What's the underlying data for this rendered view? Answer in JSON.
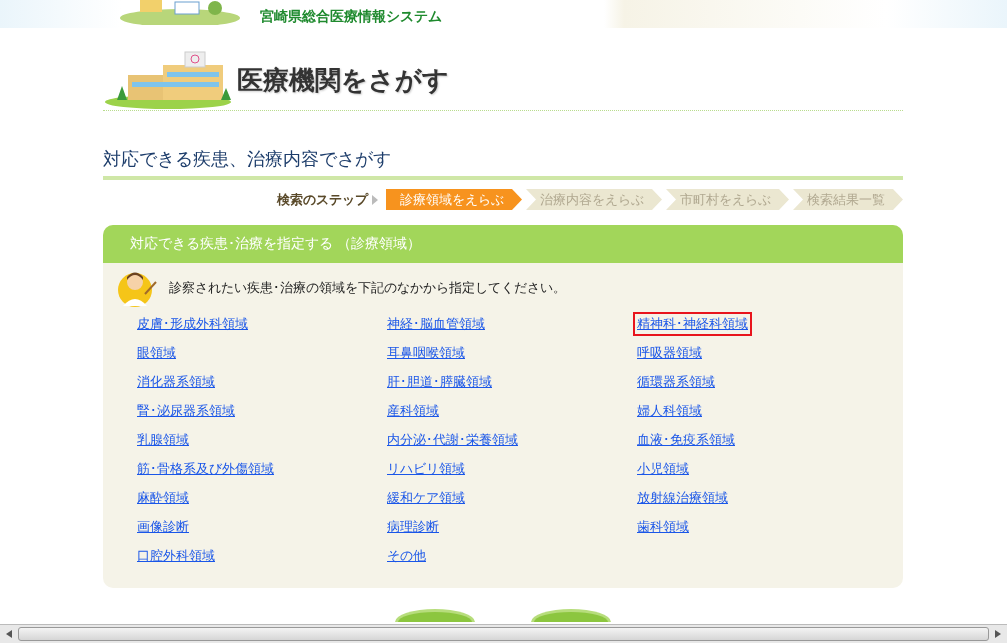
{
  "header": {
    "system_title": "宮崎県総合医療情報システム"
  },
  "page_title": "医療機関をさがす",
  "section_title": "対応できる疾患、治療内容でさがす",
  "steps": {
    "label": "検索のステップ",
    "items": [
      {
        "label": "診療領域をえらぶ",
        "selected": true
      },
      {
        "label": "治療内容をえらぶ",
        "selected": false
      },
      {
        "label": "市町村をえらぶ",
        "selected": false
      },
      {
        "label": "検索結果一覧",
        "selected": false
      }
    ]
  },
  "panel": {
    "title": "対応できる疾患･治療を指定する （診療領域）",
    "instruction": "診察されたい疾患･治療の領域を下記のなかから指定してください。",
    "links": [
      {
        "label": "皮膚･形成外科領域",
        "selected": false
      },
      {
        "label": "神経･脳血管領域",
        "selected": false
      },
      {
        "label": "精神科･神経科領域",
        "selected": true
      },
      {
        "label": "眼領域",
        "selected": false
      },
      {
        "label": "耳鼻咽喉領域",
        "selected": false
      },
      {
        "label": "呼吸器領域",
        "selected": false
      },
      {
        "label": "消化器系領域",
        "selected": false
      },
      {
        "label": "肝･胆道･膵臓領域",
        "selected": false
      },
      {
        "label": "循環器系領域",
        "selected": false
      },
      {
        "label": "腎･泌尿器系領域",
        "selected": false
      },
      {
        "label": "産科領域",
        "selected": false
      },
      {
        "label": "婦人科領域",
        "selected": false
      },
      {
        "label": "乳腺領域",
        "selected": false
      },
      {
        "label": "内分泌･代謝･栄養領域",
        "selected": false
      },
      {
        "label": "血液･免疫系領域",
        "selected": false
      },
      {
        "label": "筋･骨格系及び外傷領域",
        "selected": false
      },
      {
        "label": "リハビリ領域",
        "selected": false
      },
      {
        "label": "小児領域",
        "selected": false
      },
      {
        "label": "麻酔領域",
        "selected": false
      },
      {
        "label": "緩和ケア領域",
        "selected": false
      },
      {
        "label": "放射線治療領域",
        "selected": false
      },
      {
        "label": "画像診断",
        "selected": false
      },
      {
        "label": "病理診断",
        "selected": false
      },
      {
        "label": "歯科領域",
        "selected": false
      },
      {
        "label": "口腔外科領域",
        "selected": false
      },
      {
        "label": "その他",
        "selected": false
      }
    ]
  }
}
